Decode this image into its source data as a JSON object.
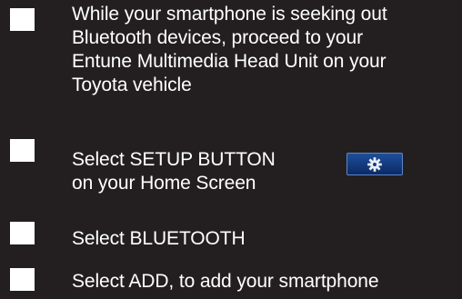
{
  "steps": [
    {
      "text": "While your smartphone is seeking out\nBluetooth devices, proceed to your\nEntune Multimedia Head Unit on your\nToyota vehicle"
    },
    {
      "text": "Select SETUP BUTTON\non your Home Screen"
    },
    {
      "text": "Select BLUETOOTH"
    },
    {
      "text": "Select ADD, to add your smartphone"
    }
  ],
  "icons": {
    "setup_button": "gear-icon"
  },
  "colors": {
    "background": "#231f20",
    "text": "#ffffff",
    "setup_button": "#1e4f9a"
  }
}
